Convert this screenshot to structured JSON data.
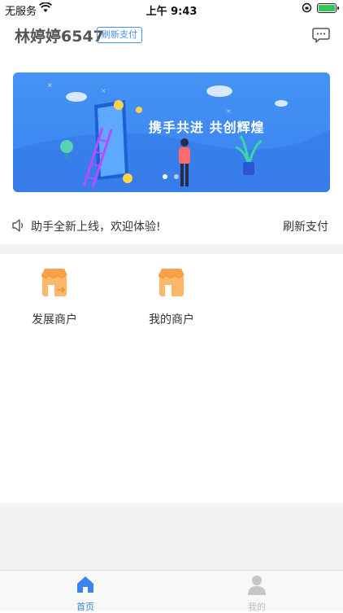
{
  "status_bar": {
    "carrier": "无服务",
    "time": "上午 9:43"
  },
  "header": {
    "user_name": "林婷婷6547",
    "refresh_badge": "刷新支付"
  },
  "banner": {
    "slogan": "携手共进 共创辉煌"
  },
  "notice": {
    "text": "助手全新上线，欢迎体验!",
    "link": "刷新支付"
  },
  "menu": {
    "items": [
      {
        "label": "发展商户",
        "icon": "store-arrow-icon"
      },
      {
        "label": "我的商户",
        "icon": "store-icon"
      }
    ]
  },
  "tabbar": {
    "tabs": [
      {
        "label": "首页",
        "icon": "home-icon",
        "active": true
      },
      {
        "label": "我的",
        "icon": "user-icon",
        "active": false
      }
    ]
  },
  "colors": {
    "accent": "#3a83f0",
    "banner_bg": "#4593f5",
    "icon_orange": "#f7a24a"
  }
}
